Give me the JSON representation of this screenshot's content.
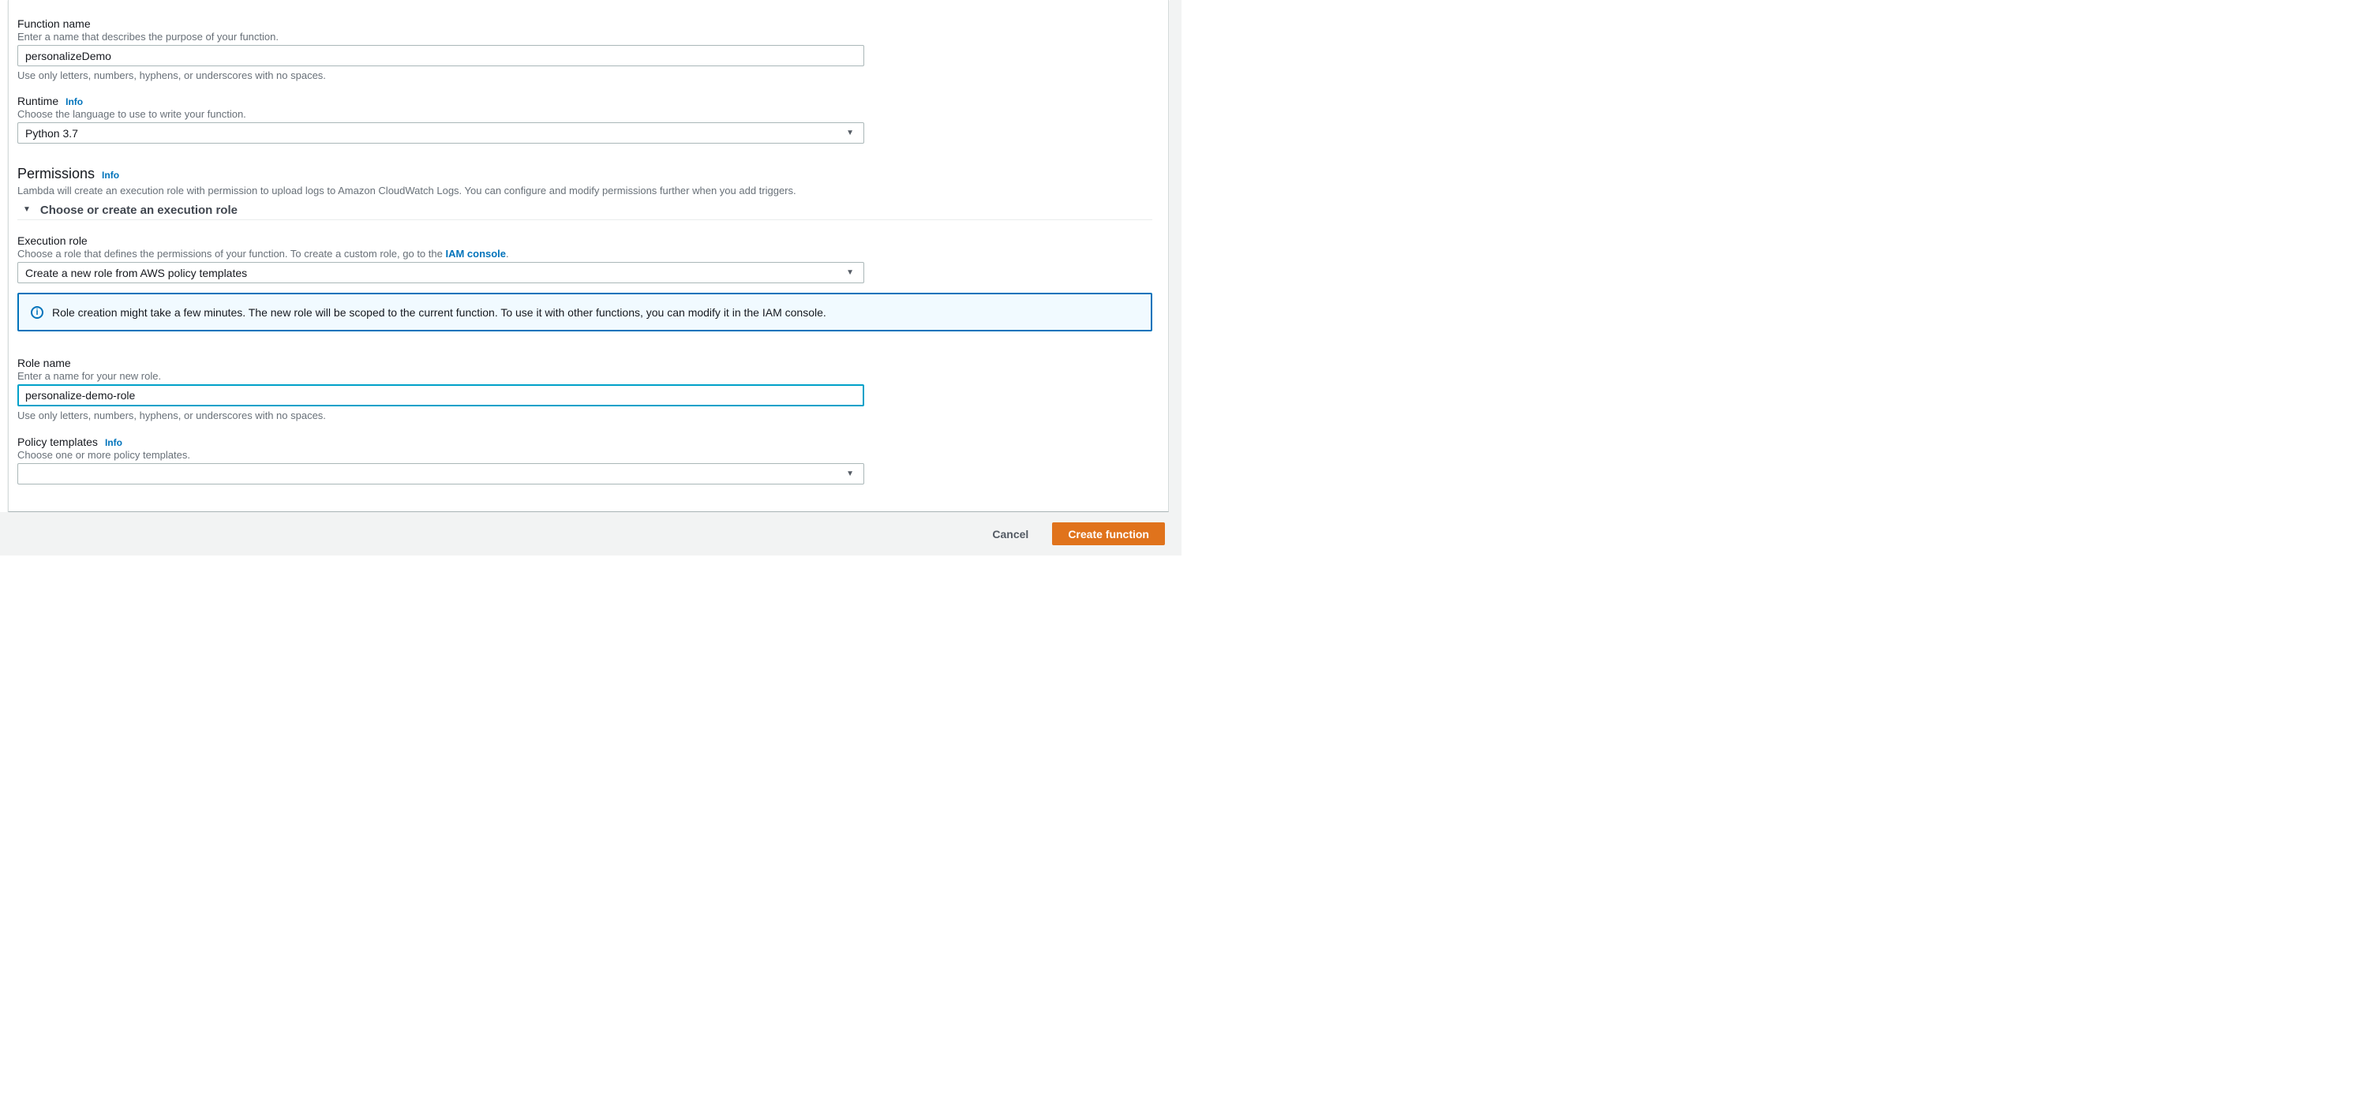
{
  "form": {
    "function_name": {
      "label": "Function name",
      "description": "Enter a name that describes the purpose of your function.",
      "value": "personalizeDemo",
      "constraint": "Use only letters, numbers, hyphens, or underscores with no spaces."
    },
    "runtime": {
      "label": "Runtime",
      "info_label": "Info",
      "description": "Choose the language to use to write your function.",
      "value": "Python 3.7"
    },
    "permissions": {
      "heading": "Permissions",
      "info_label": "Info",
      "description": "Lambda will create an execution role with permission to upload logs to Amazon CloudWatch Logs. You can configure and modify permissions further when you add triggers.",
      "expander_label": "Choose or create an execution role"
    },
    "execution_role": {
      "label": "Execution role",
      "description_prefix": "Choose a role that defines the permissions of your function. To create a custom role, go to the ",
      "link_text": "IAM console",
      "description_suffix": ".",
      "value": "Create a new role from AWS policy templates"
    },
    "role_alert": {
      "text": "Role creation might take a few minutes. The new role will be scoped to the current function. To use it with other functions, you can modify it in the IAM console."
    },
    "role_name": {
      "label": "Role name",
      "description": "Enter a name for your new role.",
      "value": "personalize-demo-role",
      "constraint": "Use only letters, numbers, hyphens, or underscores with no spaces."
    },
    "policy_templates": {
      "label": "Policy templates",
      "info_label": "Info",
      "description": "Choose one or more policy templates.",
      "value": ""
    }
  },
  "footer": {
    "cancel_label": "Cancel",
    "create_label": "Create function"
  },
  "icons": {
    "dropdown_arrow": "▼",
    "expander_arrow": "▼",
    "info_circle": "i"
  },
  "colors": {
    "link_blue": "#0073bb",
    "focus_border": "#00a1c9",
    "alert_border": "#0073bb",
    "alert_background": "#f1faff",
    "primary_button_orange": "#e0731c",
    "text_dark": "#16191f",
    "text_gray": "#687078",
    "footer_background": "#f2f3f3"
  }
}
